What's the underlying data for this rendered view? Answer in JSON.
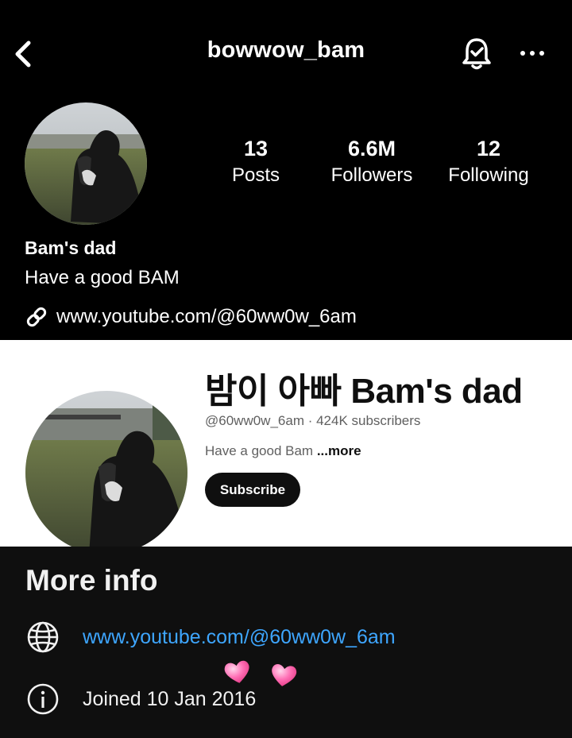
{
  "instagram": {
    "username": "bowwow_bam",
    "stats": [
      {
        "value": "13",
        "label": "Posts"
      },
      {
        "value": "6.6M",
        "label": "Followers"
      },
      {
        "value": "12",
        "label": "Following"
      }
    ],
    "display_name": "Bam's dad",
    "bio": "Have a good BAM",
    "link": "www.youtube.com/@60ww0w_6am",
    "icons": [
      "chevron-left-icon",
      "bell-icon",
      "more-icon",
      "link-icon"
    ]
  },
  "youtube": {
    "channel_name": "밤이 아빠 Bam's dad",
    "handle_line": "@60ww0w_6am · 424K subscribers",
    "description": "Have a good Bam",
    "more_label": "...more",
    "subscribe_label": "Subscribe"
  },
  "more_info": {
    "heading": "More info",
    "url": "www.youtube.com/@60ww0w_6am",
    "joined": "Joined 10 Jan 2016",
    "link_color": "#3ea6ff",
    "icons": [
      "globe-icon",
      "info-icon",
      "heart-icon"
    ]
  }
}
